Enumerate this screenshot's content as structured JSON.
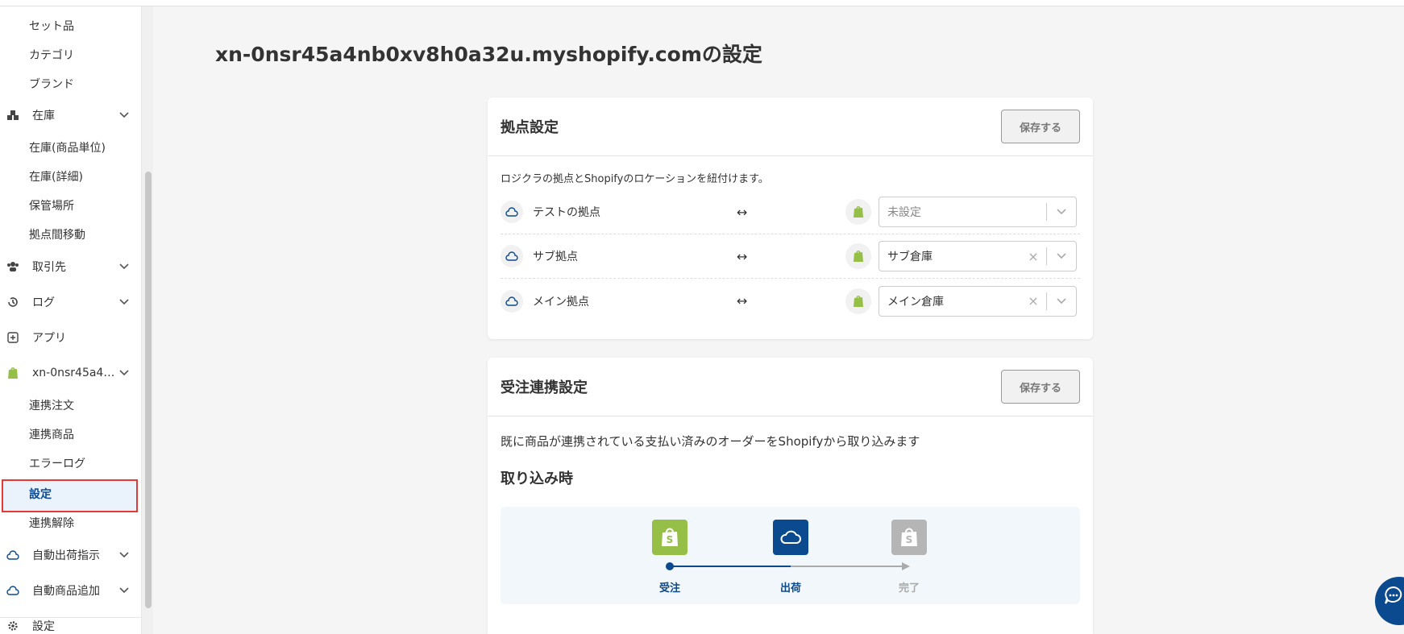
{
  "sidebar": {
    "items": [
      {
        "label": "セット品"
      },
      {
        "label": "カテゴリ"
      },
      {
        "label": "ブランド"
      },
      {
        "label": "在庫"
      },
      {
        "label": "在庫(商品単位)"
      },
      {
        "label": "在庫(詳細)"
      },
      {
        "label": "保管場所"
      },
      {
        "label": "拠点間移動"
      },
      {
        "label": "取引先"
      },
      {
        "label": "ログ"
      },
      {
        "label": "アプリ"
      },
      {
        "label": "xn-0nsr45a4nb0xv8h0a32u"
      },
      {
        "label": "連携注文"
      },
      {
        "label": "連携商品"
      },
      {
        "label": "エラーログ"
      },
      {
        "label": "設定"
      },
      {
        "label": "連携解除"
      },
      {
        "label": "自動出荷指示"
      },
      {
        "label": "自動商品追加"
      },
      {
        "label": "設定"
      }
    ]
  },
  "main": {
    "title": "xn-0nsr45a4nb0xv8h0a32u.myshopify.comの設定",
    "location_card": {
      "title": "拠点設定",
      "save_label": "保存する",
      "description": "ロジクラの拠点とShopifyのロケーションを紐付けます。",
      "arrow": "↔",
      "rows": [
        {
          "name": "テストの拠点",
          "selected": "未設定"
        },
        {
          "name": "サブ拠点",
          "selected": "サブ倉庫"
        },
        {
          "name": "メイン拠点",
          "selected": "メイン倉庫"
        }
      ]
    },
    "order_card": {
      "title": "受注連携設定",
      "save_label": "保存する",
      "description": "既に商品が連携されている支払い済みのオーダーをShopifyから取り込みます",
      "subheading": "取り込み時",
      "steps": [
        {
          "label": "受注",
          "color": "#95bf47"
        },
        {
          "label": "出荷",
          "color": "#0b4a8e"
        },
        {
          "label": "完了",
          "color": "#b5b5b5"
        }
      ]
    }
  },
  "colors": {
    "accent": "#0b4a8e",
    "shopify_green": "#95bf47",
    "highlight_border": "#e53935"
  }
}
